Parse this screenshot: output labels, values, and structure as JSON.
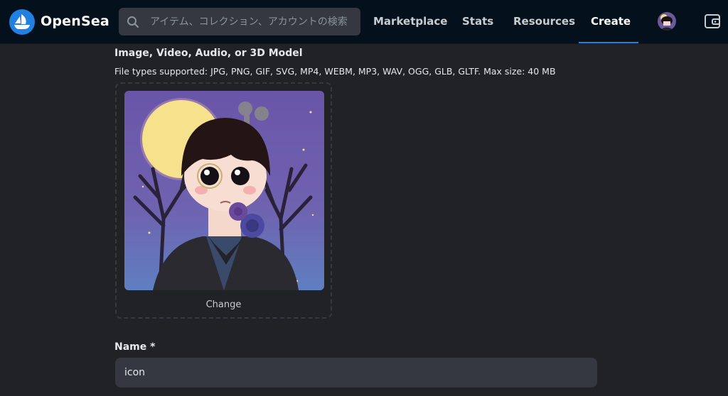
{
  "header": {
    "brand": "OpenSea",
    "search_placeholder": "アイテム、コレクション、アカウントの検索",
    "nav": [
      {
        "label": "Marketplace"
      },
      {
        "label": "Stats"
      },
      {
        "label": "Resources"
      },
      {
        "label": "Create",
        "active": true
      }
    ],
    "accent_color": "#2081e2"
  },
  "upload": {
    "title": "Image, Video, Audio, or 3D Model",
    "file_types": "File types supported: JPG, PNG, GIF, SVG, MP4, WEBM, MP3, WAV, OGG, GLB, GLTF. Max size: 40 MB",
    "change_label": "Change"
  },
  "name_field": {
    "label": "Name *",
    "value": "icon"
  }
}
